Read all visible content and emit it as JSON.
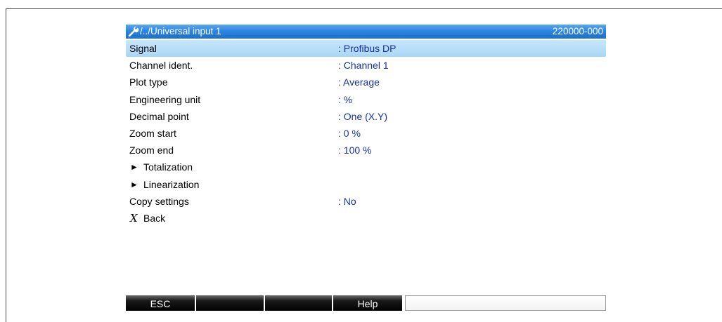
{
  "title_bar": {
    "path": "/../Universal input 1",
    "device_id": "220000-000",
    "icon": "wrench-icon"
  },
  "menu": {
    "items": [
      {
        "label": "Signal",
        "value": ": Profibus DP",
        "selected": true
      },
      {
        "label": "Channel ident.",
        "value": ": Channel 1"
      },
      {
        "label": "Plot type",
        "value": ": Average"
      },
      {
        "label": "Engineering unit",
        "value": ": %"
      },
      {
        "label": "Decimal point",
        "value": ": One (X.Y)"
      },
      {
        "label": "Zoom start",
        "value": ": 0 %"
      },
      {
        "label": "Zoom end",
        "value": ": 100 %"
      },
      {
        "label": "Totalization",
        "submenu": true
      },
      {
        "label": "Linearization",
        "submenu": true
      },
      {
        "label": "Copy settings",
        "value": ": No"
      },
      {
        "label": "Back",
        "icon": "x-icon"
      }
    ]
  },
  "softkeys": {
    "key1": "ESC",
    "key2": "",
    "key3": "",
    "key4": "Help"
  },
  "colors": {
    "title_bar": "#2f86e0",
    "selected_row": "#b5dcf8",
    "value_text": "#1631a8",
    "softkey": "#000000"
  }
}
